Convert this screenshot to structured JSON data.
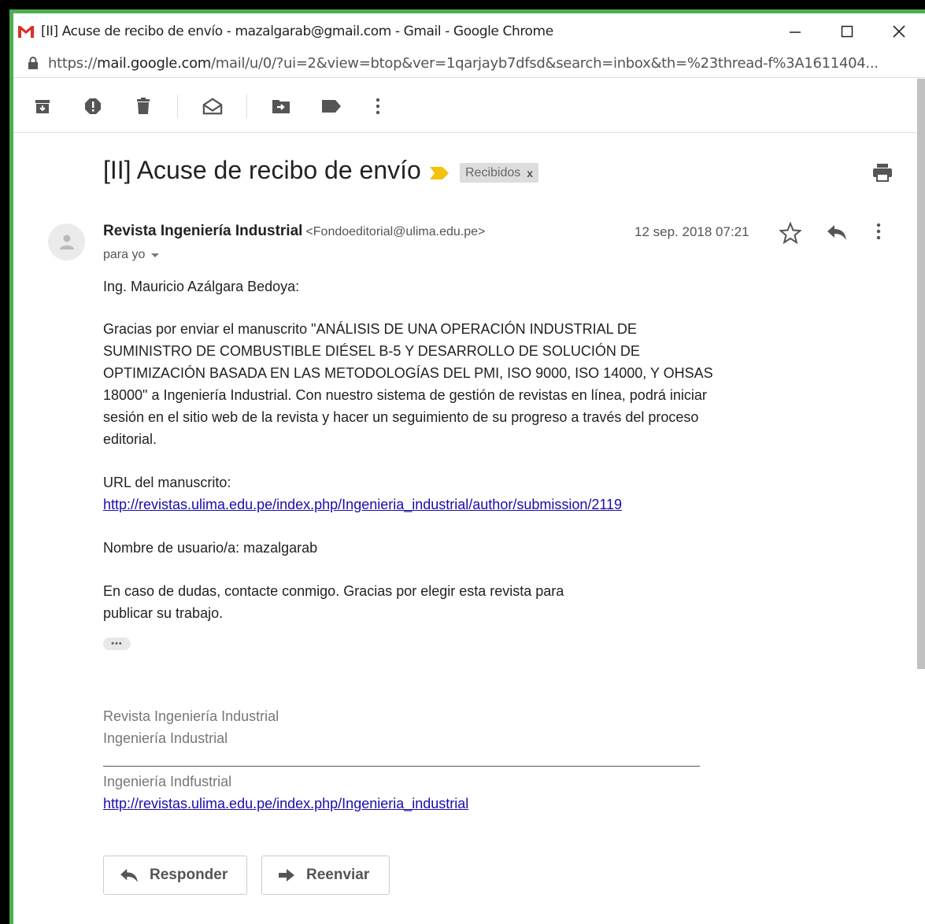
{
  "window": {
    "title": "[II] Acuse de recibo de envío - mazalgarab@gmail.com - Gmail - Google Chrome",
    "minimize_icon": "minimize-icon",
    "maximize_icon": "maximize-icon",
    "close_icon": "close-icon"
  },
  "address_bar": {
    "scheme": "https://",
    "host": "mail.google.com",
    "path": "/mail/u/0/?ui=2&view=btop&ver=1qarjayb7dfsd&search=inbox&th=%23thread-f%3A1611404..."
  },
  "toolbar": {
    "icons": [
      "archive-icon",
      "report-spam-icon",
      "delete-icon",
      "mark-unread-icon",
      "move-to-icon",
      "label-icon",
      "more-icon"
    ]
  },
  "email": {
    "subject": "[II] Acuse de recibo de envío",
    "label_chip": "Recibidos",
    "label_chip_remove": "x",
    "sender_name": "Revista Ingeniería Industrial",
    "sender_email": "<Fondoeditorial@ulima.edu.pe>",
    "date": "12 sep. 2018 07:21",
    "to": "para yo",
    "greeting": "Ing. Mauricio Azálgara Bedoya:",
    "paragraph1": "Gracias por enviar el manuscrito \"ANÁLISIS DE UNA OPERACIÓN INDUSTRIAL DE SUMINISTRO DE COMBUSTIBLE DIÉSEL B-5 Y DESARROLLO DE SOLUCIÓN DE OPTIMIZACIÓN BASADA EN LAS METODOLOGÍAS DEL PMI, ISO 9000, ISO 14000, Y OHSAS 18000\" a Ingeniería Industrial. Con nuestro sistema de gestión de revistas en línea, podrá iniciar sesión en el sitio web de la revista y hacer un seguimiento de su progreso a través del proceso editorial.",
    "url_label": "URL del manuscrito:",
    "url_link": "http://revistas.ulima.edu.pe/index.php/Ingenieria_industrial/author/submission/2119",
    "username_line": "Nombre de usuario/a: mazalgarab",
    "closing": "En caso de dudas, contacte conmigo. Gracias por elegir esta revista para publicar su trabajo.",
    "ellipsis": "•••",
    "signature_line1": "Revista Ingeniería Industrial",
    "signature_line2": "Ingeniería Industrial",
    "footer_line": "Ingeniería Indfustrial",
    "footer_link": "http://revistas.ulima.edu.pe/index.php/Ingenieria_industrial"
  },
  "actions": {
    "reply": "Responder",
    "forward": "Reenviar"
  },
  "colors": {
    "gmail_red": "#d93025",
    "label_yellow": "#f4c20d",
    "link": "#1a0dab",
    "window_border": "#4caf50"
  }
}
